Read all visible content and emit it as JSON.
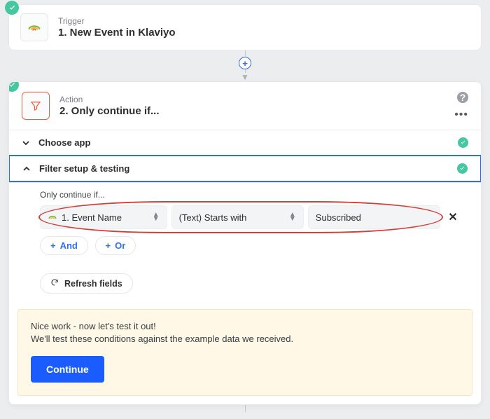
{
  "trigger": {
    "type_label": "Trigger",
    "title": "1. New Event in Klaviyo"
  },
  "action": {
    "type_label": "Action",
    "title": "2. Only continue if...",
    "sections": {
      "choose_app": "Choose app",
      "filter_setup": "Filter setup & testing"
    },
    "filter": {
      "prompt": "Only continue if...",
      "field_value": "1. Event Name",
      "operator_value": "(Text) Starts with",
      "match_value": "Subscribed",
      "and_label": "And",
      "or_label": "Or",
      "refresh_label": "Refresh fields"
    },
    "test": {
      "line1": "Nice work - now let's test it out!",
      "line2": "We'll test these conditions against the example data we received.",
      "continue_label": "Continue"
    }
  }
}
